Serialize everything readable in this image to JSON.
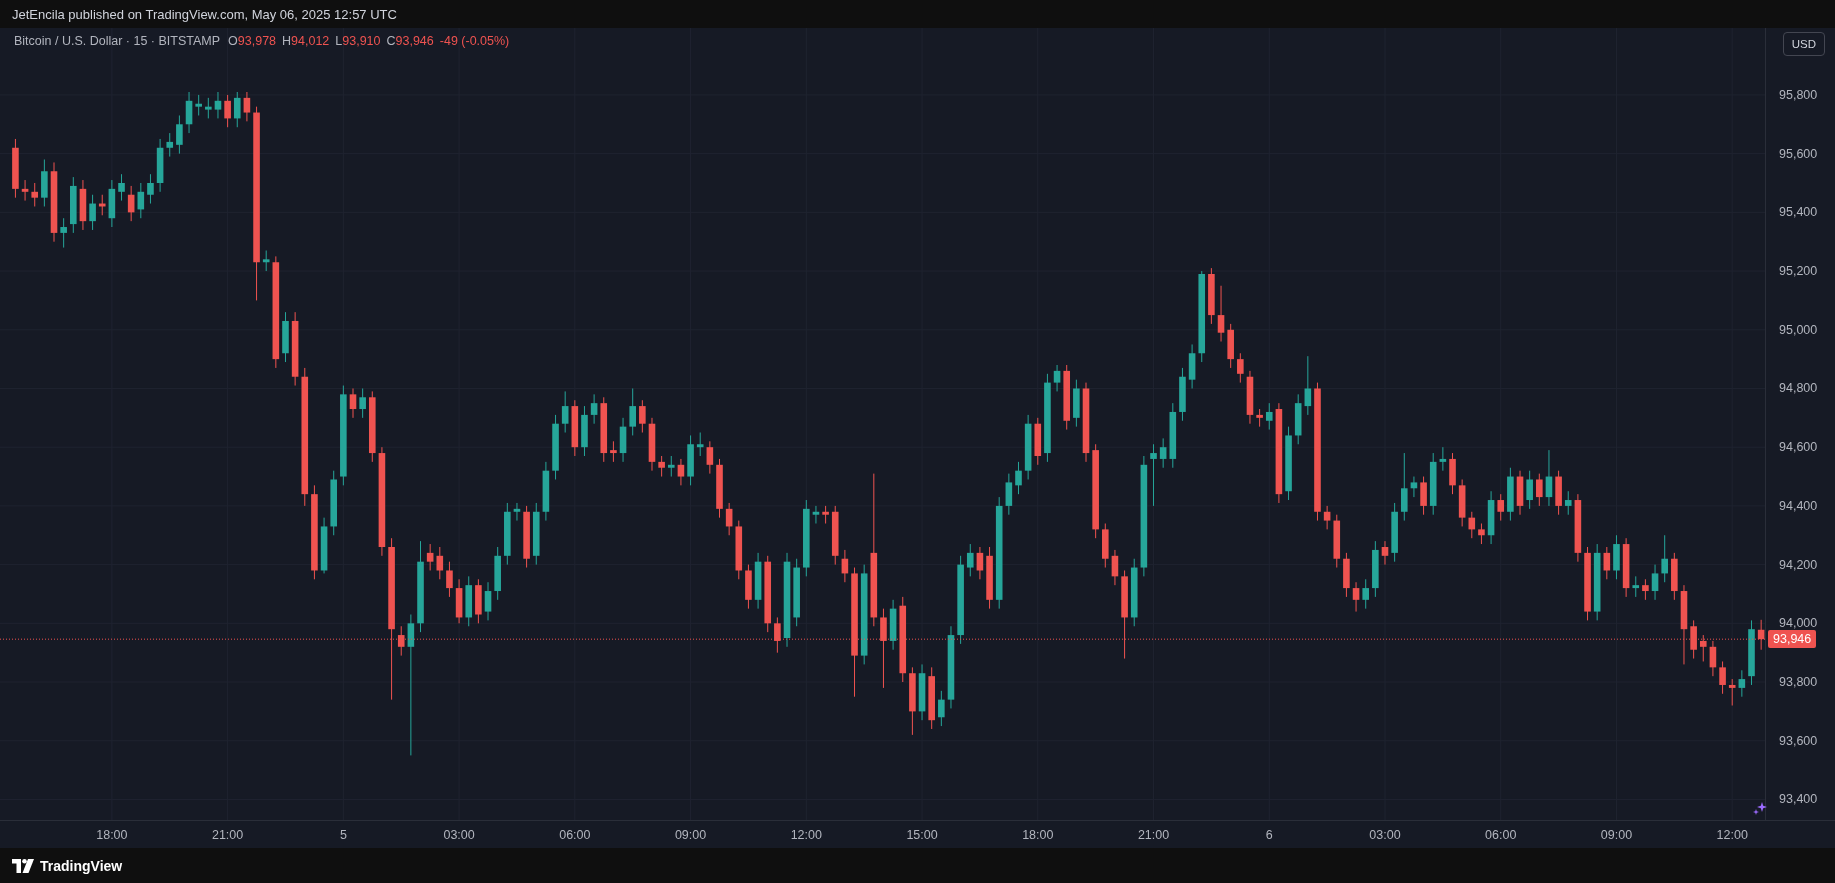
{
  "header": {
    "text": "JetEncila published on TradingView.com, May 06, 2025 12:57 UTC"
  },
  "chart": {
    "legend": {
      "symbol": "Bitcoin / U.S. Dollar · 15 · BITSTAMP",
      "ohlc": [
        {
          "label": "O",
          "value": "93,978"
        },
        {
          "label": "H",
          "value": "94,012"
        },
        {
          "label": "L",
          "value": "93,910"
        },
        {
          "label": "C",
          "value": "93,946"
        }
      ],
      "change": "-49 (-0.05%)"
    },
    "currency": "USD",
    "chart_data": {
      "type": "candlestick",
      "ylim": [
        93330,
        96028
      ],
      "grid": true,
      "ref_lines": [
        {
          "axis": "y",
          "value": 93946,
          "label": "93,946",
          "color": "#ef5350"
        }
      ],
      "yticks": [
        {
          "value": 95800,
          "label": "95,800"
        },
        {
          "value": 95600,
          "label": "95,600"
        },
        {
          "value": 95400,
          "label": "95,400"
        },
        {
          "value": 95200,
          "label": "95,200"
        },
        {
          "value": 95000,
          "label": "95,000"
        },
        {
          "value": 94800,
          "label": "94,800"
        },
        {
          "value": 94600,
          "label": "94,600"
        },
        {
          "value": 94400,
          "label": "94,400"
        },
        {
          "value": 94200,
          "label": "94,200"
        },
        {
          "value": 94000,
          "label": "94,000"
        },
        {
          "value": 93800,
          "label": "93,800"
        },
        {
          "value": 93600,
          "label": "93,600"
        },
        {
          "value": 93400,
          "label": "93,400"
        }
      ],
      "categories": [
        null,
        null,
        null,
        null,
        null,
        null,
        null,
        null,
        null,
        null,
        "18:00",
        null,
        null,
        null,
        null,
        null,
        null,
        null,
        null,
        null,
        null,
        null,
        "21:00",
        null,
        null,
        null,
        null,
        null,
        null,
        null,
        null,
        null,
        null,
        null,
        "5",
        null,
        null,
        null,
        null,
        null,
        null,
        null,
        null,
        null,
        null,
        null,
        "03:00",
        null,
        null,
        null,
        null,
        null,
        null,
        null,
        null,
        null,
        null,
        null,
        "06:00",
        null,
        null,
        null,
        null,
        null,
        null,
        null,
        null,
        null,
        null,
        null,
        "09:00",
        null,
        null,
        null,
        null,
        null,
        null,
        null,
        null,
        null,
        null,
        null,
        "12:00",
        null,
        null,
        null,
        null,
        null,
        null,
        null,
        null,
        null,
        null,
        null,
        "15:00",
        null,
        null,
        null,
        null,
        null,
        null,
        null,
        null,
        null,
        null,
        null,
        "18:00",
        null,
        null,
        null,
        null,
        null,
        null,
        null,
        null,
        null,
        null,
        null,
        "21:00",
        null,
        null,
        null,
        null,
        null,
        null,
        null,
        null,
        null,
        null,
        null,
        "6",
        null,
        null,
        null,
        null,
        null,
        null,
        null,
        null,
        null,
        null,
        null,
        "03:00",
        null,
        null,
        null,
        null,
        null,
        null,
        null,
        null,
        null,
        null,
        null,
        "06:00",
        null,
        null,
        null,
        null,
        null,
        null,
        null,
        null,
        null,
        null,
        null,
        "09:00",
        null,
        null,
        null,
        null,
        null,
        null,
        null,
        null,
        null,
        null,
        null,
        "12:00",
        null,
        null,
        null
      ],
      "ohlc": [
        [
          95620,
          95650,
          95450,
          95480
        ],
        [
          95480,
          95510,
          95440,
          95470
        ],
        [
          95470,
          95500,
          95420,
          95450
        ],
        [
          95450,
          95580,
          95420,
          95540
        ],
        [
          95540,
          95570,
          95300,
          95330
        ],
        [
          95330,
          95380,
          95280,
          95350
        ],
        [
          95360,
          95520,
          95330,
          95490
        ],
        [
          95480,
          95510,
          95340,
          95370
        ],
        [
          95370,
          95460,
          95340,
          95430
        ],
        [
          95430,
          95460,
          95390,
          95420
        ],
        [
          95380,
          95510,
          95350,
          95480
        ],
        [
          95470,
          95530,
          95440,
          95500
        ],
        [
          95460,
          95490,
          95370,
          95400
        ],
        [
          95410,
          95500,
          95380,
          95470
        ],
        [
          95460,
          95530,
          95430,
          95500
        ],
        [
          95500,
          95650,
          95470,
          95620
        ],
        [
          95620,
          95670,
          95590,
          95640
        ],
        [
          95630,
          95730,
          95600,
          95700
        ],
        [
          95700,
          95810,
          95670,
          95780
        ],
        [
          95760,
          95800,
          95730,
          95770
        ],
        [
          95750,
          95790,
          95720,
          95760
        ],
        [
          95750,
          95810,
          95720,
          95780
        ],
        [
          95780,
          95800,
          95690,
          95720
        ],
        [
          95720,
          95810,
          95690,
          95790
        ],
        [
          95790,
          95810,
          95710,
          95740
        ],
        [
          95740,
          95760,
          95100,
          95230
        ],
        [
          95230,
          95270,
          95200,
          95240
        ],
        [
          95230,
          95250,
          94870,
          94900
        ],
        [
          94920,
          95060,
          94890,
          95030
        ],
        [
          95030,
          95060,
          94810,
          94840
        ],
        [
          94840,
          94870,
          94400,
          94440
        ],
        [
          94440,
          94470,
          94150,
          94180
        ],
        [
          94180,
          94360,
          94170,
          94330
        ],
        [
          94330,
          94520,
          94300,
          94490
        ],
        [
          94500,
          94810,
          94470,
          94780
        ],
        [
          94780,
          94800,
          94700,
          94730
        ],
        [
          94730,
          94800,
          94700,
          94770
        ],
        [
          94770,
          94790,
          94550,
          94580
        ],
        [
          94580,
          94600,
          94230,
          94260
        ],
        [
          94260,
          94290,
          93740,
          93980
        ],
        [
          93960,
          93990,
          93890,
          93920
        ],
        [
          93920,
          94030,
          93550,
          94000
        ],
        [
          94000,
          94280,
          93970,
          94210
        ],
        [
          94240,
          94270,
          94180,
          94210
        ],
        [
          94230,
          94260,
          94150,
          94180
        ],
        [
          94180,
          94210,
          94090,
          94120
        ],
        [
          94120,
          94150,
          94000,
          94020
        ],
        [
          94020,
          94160,
          93990,
          94130
        ],
        [
          94130,
          94150,
          94000,
          94030
        ],
        [
          94040,
          94140,
          94010,
          94110
        ],
        [
          94110,
          94260,
          94080,
          94230
        ],
        [
          94230,
          94410,
          94200,
          94380
        ],
        [
          94380,
          94410,
          94350,
          94390
        ],
        [
          94380,
          94400,
          94190,
          94220
        ],
        [
          94230,
          94410,
          94200,
          94380
        ],
        [
          94380,
          94550,
          94350,
          94520
        ],
        [
          94520,
          94710,
          94490,
          94680
        ],
        [
          94680,
          94790,
          94650,
          94740
        ],
        [
          94740,
          94760,
          94570,
          94600
        ],
        [
          94600,
          94740,
          94570,
          94710
        ],
        [
          94710,
          94780,
          94680,
          94750
        ],
        [
          94750,
          94770,
          94550,
          94580
        ],
        [
          94590,
          94620,
          94550,
          94580
        ],
        [
          94580,
          94700,
          94550,
          94670
        ],
        [
          94670,
          94800,
          94640,
          94740
        ],
        [
          94740,
          94760,
          94650,
          94680
        ],
        [
          94680,
          94700,
          94520,
          94550
        ],
        [
          94550,
          94570,
          94500,
          94530
        ],
        [
          94530,
          94570,
          94500,
          94540
        ],
        [
          94540,
          94560,
          94470,
          94500
        ],
        [
          94500,
          94640,
          94470,
          94610
        ],
        [
          94600,
          94650,
          94570,
          94610
        ],
        [
          94600,
          94620,
          94510,
          94540
        ],
        [
          94540,
          94560,
          94360,
          94390
        ],
        [
          94390,
          94410,
          94300,
          94330
        ],
        [
          94330,
          94350,
          94150,
          94180
        ],
        [
          94180,
          94200,
          94050,
          94080
        ],
        [
          94080,
          94240,
          94050,
          94210
        ],
        [
          94210,
          94230,
          93970,
          94000
        ],
        [
          94000,
          94020,
          93900,
          93940
        ],
        [
          93950,
          94240,
          93920,
          94210
        ],
        [
          94020,
          94220,
          93990,
          94190
        ],
        [
          94190,
          94420,
          94160,
          94390
        ],
        [
          94370,
          94400,
          94340,
          94380
        ],
        [
          94380,
          94400,
          94340,
          94370
        ],
        [
          94380,
          94400,
          94200,
          94230
        ],
        [
          94220,
          94250,
          94140,
          94170
        ],
        [
          94170,
          94190,
          93750,
          93890
        ],
        [
          93890,
          94200,
          93860,
          94170
        ],
        [
          94240,
          94510,
          93990,
          94020
        ],
        [
          94020,
          94050,
          93780,
          93940
        ],
        [
          93940,
          94080,
          93910,
          94050
        ],
        [
          94060,
          94090,
          93800,
          93830
        ],
        [
          93830,
          93850,
          93620,
          93700
        ],
        [
          93700,
          93860,
          93670,
          93830
        ],
        [
          93820,
          93850,
          93640,
          93670
        ],
        [
          93680,
          93770,
          93650,
          93740
        ],
        [
          93740,
          93990,
          93710,
          93960
        ],
        [
          93960,
          94230,
          93930,
          94200
        ],
        [
          94190,
          94270,
          94160,
          94240
        ],
        [
          94240,
          94260,
          94150,
          94180
        ],
        [
          94230,
          94260,
          94050,
          94080
        ],
        [
          94080,
          94430,
          94050,
          94400
        ],
        [
          94400,
          94510,
          94370,
          94480
        ],
        [
          94470,
          94550,
          94440,
          94520
        ],
        [
          94520,
          94710,
          94490,
          94680
        ],
        [
          94680,
          94700,
          94540,
          94570
        ],
        [
          94580,
          94850,
          94550,
          94820
        ],
        [
          94820,
          94880,
          94790,
          94860
        ],
        [
          94860,
          94880,
          94660,
          94690
        ],
        [
          94700,
          94830,
          94670,
          94800
        ],
        [
          94800,
          94820,
          94550,
          94580
        ],
        [
          94590,
          94610,
          94290,
          94320
        ],
        [
          94320,
          94340,
          94190,
          94220
        ],
        [
          94230,
          94250,
          94130,
          94160
        ],
        [
          94160,
          94180,
          93880,
          94020
        ],
        [
          94020,
          94220,
          93990,
          94190
        ],
        [
          94190,
          94570,
          94160,
          94540
        ],
        [
          94560,
          94610,
          94400,
          94580
        ],
        [
          94560,
          94630,
          94530,
          94600
        ],
        [
          94560,
          94750,
          94530,
          94720
        ],
        [
          94720,
          94870,
          94690,
          94840
        ],
        [
          94830,
          94950,
          94800,
          94920
        ],
        [
          94920,
          95200,
          94890,
          95190
        ],
        [
          95190,
          95210,
          95020,
          95050
        ],
        [
          95050,
          95150,
          94960,
          94990
        ],
        [
          95000,
          95020,
          94870,
          94900
        ],
        [
          94900,
          94920,
          94820,
          94850
        ],
        [
          94840,
          94860,
          94680,
          94710
        ],
        [
          94710,
          94730,
          94670,
          94700
        ],
        [
          94690,
          94750,
          94660,
          94720
        ],
        [
          94730,
          94750,
          94410,
          94440
        ],
        [
          94450,
          94670,
          94420,
          94640
        ],
        [
          94640,
          94780,
          94610,
          94750
        ],
        [
          94740,
          94910,
          94710,
          94800
        ],
        [
          94800,
          94820,
          94350,
          94380
        ],
        [
          94380,
          94400,
          94320,
          94350
        ],
        [
          94350,
          94370,
          94190,
          94220
        ],
        [
          94220,
          94240,
          94090,
          94120
        ],
        [
          94120,
          94140,
          94040,
          94080
        ],
        [
          94080,
          94150,
          94050,
          94120
        ],
        [
          94120,
          94280,
          94090,
          94250
        ],
        [
          94260,
          94280,
          94200,
          94230
        ],
        [
          94240,
          94410,
          94210,
          94380
        ],
        [
          94380,
          94580,
          94350,
          94460
        ],
        [
          94460,
          94500,
          94430,
          94480
        ],
        [
          94480,
          94500,
          94370,
          94400
        ],
        [
          94400,
          94580,
          94370,
          94550
        ],
        [
          94550,
          94600,
          94520,
          94560
        ],
        [
          94560,
          94580,
          94440,
          94470
        ],
        [
          94470,
          94490,
          94330,
          94360
        ],
        [
          94360,
          94380,
          94290,
          94320
        ],
        [
          94320,
          94340,
          94270,
          94300
        ],
        [
          94300,
          94450,
          94270,
          94420
        ],
        [
          94420,
          94440,
          94350,
          94380
        ],
        [
          94380,
          94530,
          94350,
          94500
        ],
        [
          94500,
          94520,
          94370,
          94400
        ],
        [
          94420,
          94520,
          94390,
          94490
        ],
        [
          94490,
          94510,
          94400,
          94430
        ],
        [
          94430,
          94590,
          94400,
          94500
        ],
        [
          94500,
          94520,
          94370,
          94400
        ],
        [
          94400,
          94450,
          94370,
          94420
        ],
        [
          94420,
          94440,
          94210,
          94240
        ],
        [
          94240,
          94260,
          94010,
          94040
        ],
        [
          94040,
          94270,
          94010,
          94240
        ],
        [
          94240,
          94260,
          94150,
          94180
        ],
        [
          94180,
          94300,
          94150,
          94270
        ],
        [
          94270,
          94290,
          94090,
          94120
        ],
        [
          94120,
          94160,
          94090,
          94130
        ],
        [
          94130,
          94150,
          94080,
          94110
        ],
        [
          94110,
          94200,
          94080,
          94170
        ],
        [
          94170,
          94300,
          94140,
          94220
        ],
        [
          94220,
          94240,
          94080,
          94110
        ],
        [
          94110,
          94130,
          93860,
          93980
        ],
        [
          93990,
          94010,
          93880,
          93910
        ],
        [
          93940,
          93960,
          93870,
          93920
        ],
        [
          93920,
          93940,
          93820,
          93850
        ],
        [
          93850,
          93870,
          93760,
          93790
        ],
        [
          93790,
          93810,
          93720,
          93780
        ],
        [
          93780,
          93840,
          93750,
          93810
        ],
        [
          93820,
          94010,
          93790,
          93980
        ],
        [
          93978,
          94012,
          93910,
          93946
        ]
      ]
    }
  },
  "footer": {
    "brand": "TradingView"
  }
}
